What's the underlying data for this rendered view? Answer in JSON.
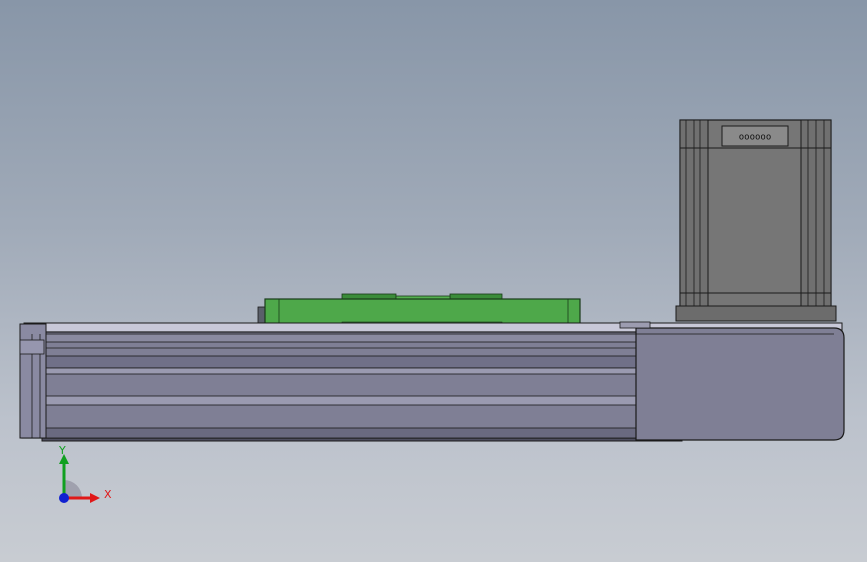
{
  "triad": {
    "x_label": "X",
    "y_label": "Y",
    "x_color": "#e01818",
    "y_color": "#10a020",
    "z_color": "#1020d0"
  },
  "motor": {
    "connector_pins": "oooooo"
  },
  "colors": {
    "background_top": "#8896a8",
    "background_bottom": "#c8ccd2",
    "rail_body": "#7f7f95",
    "carriage": "#4ea84a",
    "motor_body": "#767676"
  }
}
